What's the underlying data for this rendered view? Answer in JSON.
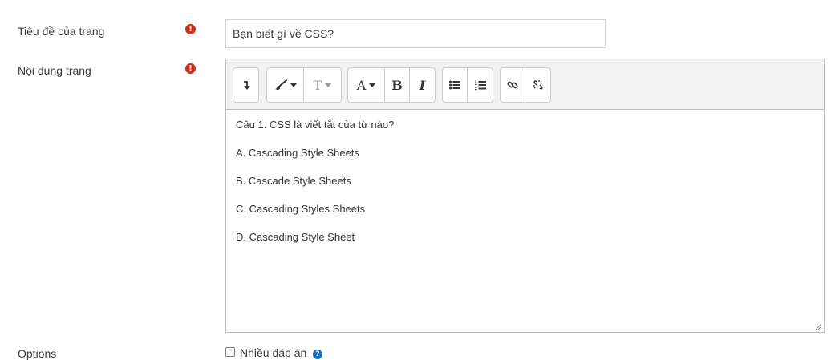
{
  "form": {
    "title_field": {
      "label": "Tiêu đề của trang",
      "value": "Bạn biết gì về CSS?",
      "required_icon": "exclamation-circle-icon"
    },
    "content_field": {
      "label": "Nội dung trang",
      "required_icon": "exclamation-circle-icon"
    },
    "options": {
      "label": "Options",
      "checkbox_label": "Nhiều đáp án",
      "checked": false,
      "help_icon": "question-circle-icon"
    }
  },
  "editor": {
    "toolbar": {
      "groups": [
        [
          "collapse-icon"
        ],
        [
          "paintbrush-icon",
          "text-style-icon"
        ],
        [
          "font-color-icon",
          "bold-icon",
          "italic-icon"
        ],
        [
          "unordered-list-icon",
          "ordered-list-icon"
        ],
        [
          "link-icon",
          "unlink-icon"
        ]
      ],
      "labels": {
        "font_color": "A",
        "bold": "B",
        "italic": "I",
        "text_style": "T"
      }
    },
    "content": [
      "Câu 1. CSS là viết tắt của từ nào?",
      "A. Cascading Style Sheets",
      "B. Cascade Style Sheets",
      "C. Cascading Styles Sheets",
      "D. Cascading Style Sheet"
    ]
  },
  "colors": {
    "required": "#ca3120",
    "help": "#0f6fc5",
    "toolbar_bg": "#f2f2f2",
    "border": "#bbbbbb"
  }
}
